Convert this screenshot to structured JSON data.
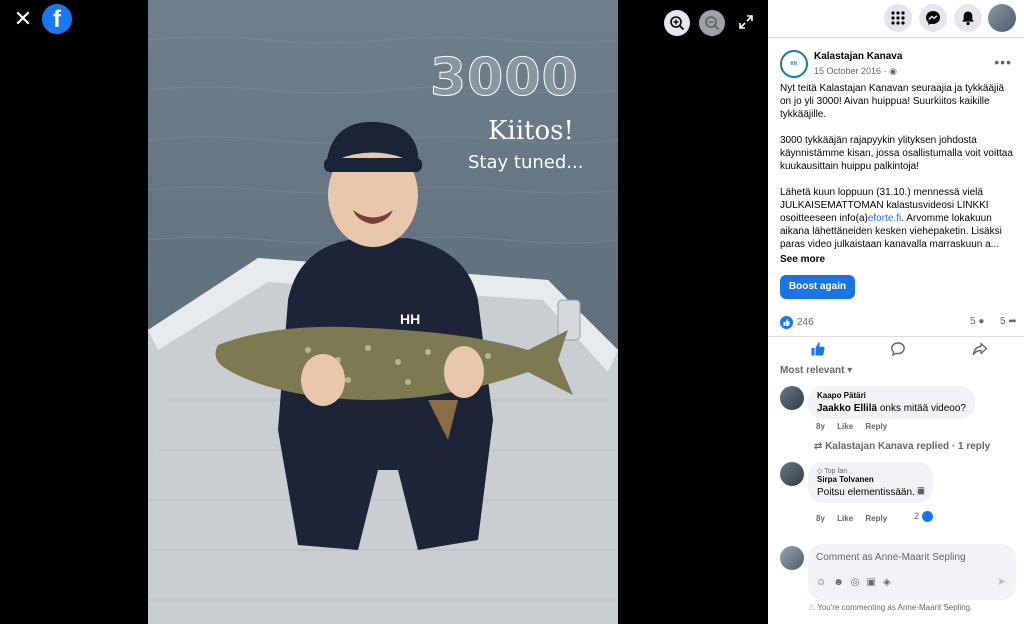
{
  "viewer": {
    "close_icon": "close-icon",
    "logo_letter": "f",
    "overlay": {
      "big": "3000",
      "line2": "Kiitos!",
      "line3": "Stay tuned..."
    }
  },
  "topbar": {
    "icons": [
      "grid-menu-icon",
      "messenger-icon",
      "bell-icon",
      "profile-avatar"
    ]
  },
  "post": {
    "page_name": "Kalastajan Kanava",
    "date": "15 October 2016 ·",
    "paragraph1": "Nyt teitä Kalastajan Kanavan seuraajia ja tykkääjiä on jo yli 3000! Aivan huippua! Suurkiitos kaikille tykkääjille.",
    "paragraph2": "3000 tykkääjän rajapyykin ylityksen johdosta käynnistämme kisan, jossa osallistumalla voit voittaa kuukausittain huippu palkintoja!",
    "paragraph3_a": "Lähetä kuun loppuun (31.10.) mennessä vielä JULKAISEMATTOMAN kalastusvideosi LINKKI osoitteeseen info(a)",
    "paragraph3_link": "eforte.fi",
    "paragraph3_b": ". Arvomme lokakuun aikana lähettäneiden kesken viehepaketin. Lisäksi paras video julkaistaan kanavalla marraskuun a...",
    "see_more": "See more",
    "boost": "Boost again",
    "likes": "246",
    "comments_count": "5",
    "shares_count": "5"
  },
  "comments": {
    "sort_label": "Most relevant",
    "items": [
      {
        "author": "Kaapo Pätäri",
        "text_name": "Jaakko Ellilä",
        "text": " onks mitää videoo?",
        "time": "8y",
        "like": "Like",
        "reply": "Reply"
      },
      {
        "replied_line": "Kalastajan Kanava replied · 1 reply"
      },
      {
        "badge": "Top fan",
        "author": "Sirpa Tolvanen",
        "text": "Poitsu elementissään. 𝄜",
        "time": "8y",
        "like": "Like",
        "reply": "Reply",
        "reaction_count": "2"
      }
    ]
  },
  "composer": {
    "placeholder": "Comment as Anne-Maarit Sepling",
    "notice": "You're commenting as Anne-Maarit Sepling."
  }
}
